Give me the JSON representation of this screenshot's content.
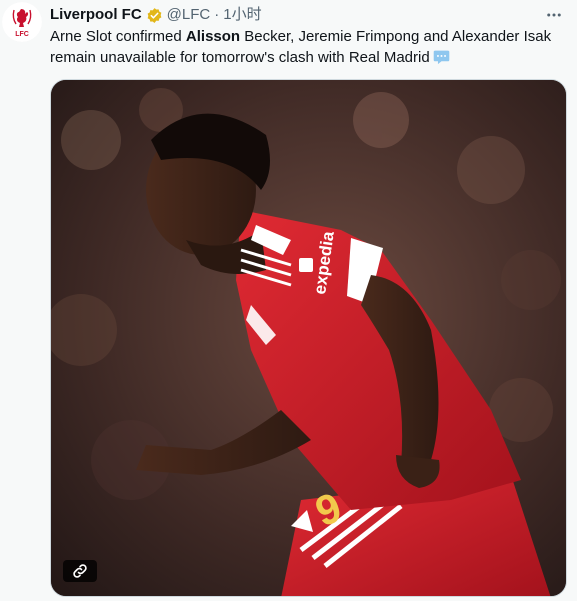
{
  "account": {
    "name": "Liverpool FC",
    "handle": "@LFC",
    "separator": "·",
    "time": "1小时",
    "verified_color": "#e2b719"
  },
  "tweet": {
    "text_before": "Arne Slot confirmed ",
    "text_bold": "Alisson",
    "text_after": " Becker, Jeremie Frimpong and Alexander Isak remain unavailable for tomorrow's clash with Real Madrid"
  },
  "media": {
    "description_icon": "link-icon",
    "shirt_sponsor": "expedia",
    "shirt_number": "9"
  },
  "avatar": {
    "crest_text": "LFC"
  },
  "colors": {
    "brand_red": "#c8102e",
    "text_primary": "#0f1419",
    "text_secondary": "#536471"
  }
}
